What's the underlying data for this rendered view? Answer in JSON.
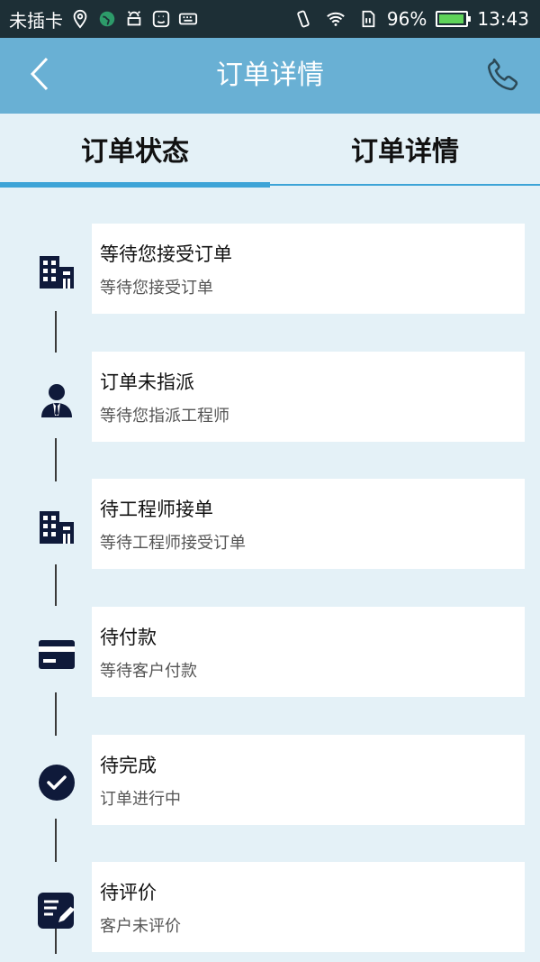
{
  "status_bar": {
    "carrier": "未插卡",
    "battery": "96%",
    "time": "13:43",
    "battery_level": 0.96
  },
  "header": {
    "title": "订单详情"
  },
  "tabs": [
    {
      "label": "订单状态",
      "active": true
    },
    {
      "label": "订单详情",
      "active": false
    }
  ],
  "steps": [
    {
      "icon": "building-icon",
      "title": "等待您接受订单",
      "subtitle": "等待您接受订单"
    },
    {
      "icon": "person-icon",
      "title": "订单未指派",
      "subtitle": "等待您指派工程师"
    },
    {
      "icon": "building-icon",
      "title": "待工程师接单",
      "subtitle": "等待工程师接受订单"
    },
    {
      "icon": "card-icon",
      "title": "待付款",
      "subtitle": "等待客户付款"
    },
    {
      "icon": "check-circle-icon",
      "title": "待完成",
      "subtitle": "订单进行中"
    },
    {
      "icon": "edit-note-icon",
      "title": "待评价",
      "subtitle": "客户未评价"
    }
  ],
  "colors": {
    "status_bar": "#1d2f36",
    "header": "#69b0d4",
    "background": "#e4f1f7",
    "accent": "#3da4d7",
    "icon": "#0f1a3a"
  }
}
